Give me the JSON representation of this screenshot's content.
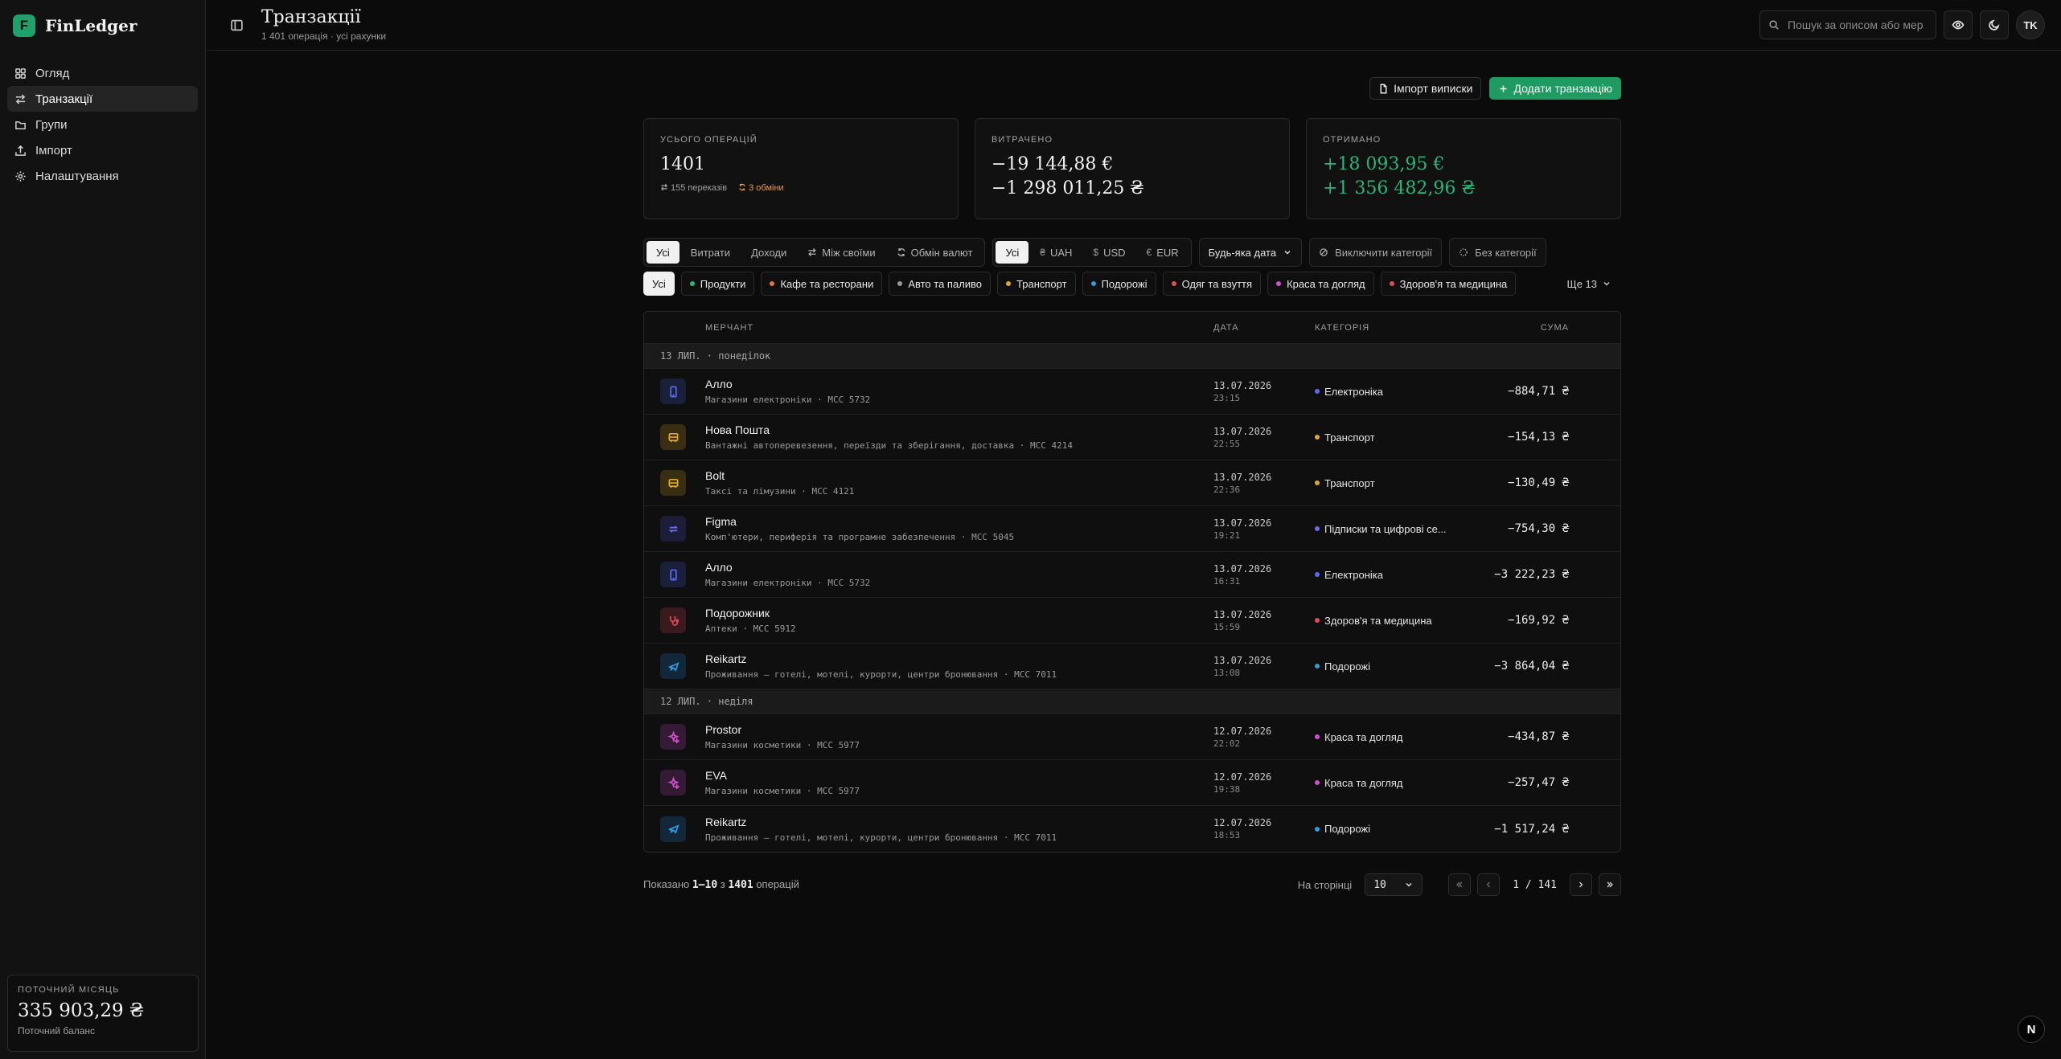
{
  "app": {
    "name": "FinLedger",
    "logo_letter": "F",
    "accent": "#22a06b"
  },
  "sidebar": {
    "items": [
      {
        "label": "Огляд",
        "icon": "grid-icon"
      },
      {
        "label": "Транзакції",
        "icon": "transfer-icon"
      },
      {
        "label": "Групи",
        "icon": "folder-icon"
      },
      {
        "label": "Імпорт",
        "icon": "upload-icon"
      },
      {
        "label": "Налаштування",
        "icon": "gear-icon"
      }
    ],
    "active_index": 1,
    "balance": {
      "label": "ПОТОЧНИЙ МІСЯЦЬ",
      "value": "335 903,29 ₴",
      "sub": "Поточний баланс"
    }
  },
  "header": {
    "title": "Транзакції",
    "subtitle": "1 401 операція · усі рахунки",
    "search_placeholder": "Пошук за описом або мер",
    "avatar": "TK"
  },
  "actions": {
    "import": "Імпорт виписки",
    "add": "Додати транзакцію"
  },
  "stats": {
    "total": {
      "label": "УСЬОГО ОПЕРАЦІЙ",
      "value": "1401",
      "transfers": "155 переказів",
      "exchanges": "3 обміни"
    },
    "spent": {
      "label": "ВИТРАЧЕНО",
      "eur": "−19 144,88 €",
      "uah": "−1 298 011,25 ₴"
    },
    "received": {
      "label": "ОТРИМАНО",
      "eur": "+18 093,95 €",
      "uah": "+1 356 482,96 ₴"
    }
  },
  "filters": {
    "type": [
      "Усі",
      "Витрати",
      "Доходи",
      "Між своїми",
      "Обмін валют"
    ],
    "currency": [
      {
        "label": "Усі",
        "symbol": ""
      },
      {
        "label": "UAH",
        "symbol": "₴"
      },
      {
        "label": "USD",
        "symbol": "$"
      },
      {
        "label": "EUR",
        "symbol": "€"
      }
    ],
    "date": "Будь-яка дата",
    "exclude": "Виключити категорії",
    "no_category": "Без категорії",
    "categories": [
      {
        "label": "Усі",
        "color": ""
      },
      {
        "label": "Продукти",
        "color": "#2bb47a"
      },
      {
        "label": "Кафе та ресторани",
        "color": "#e8743c"
      },
      {
        "label": "Авто та паливо",
        "color": "#9a9a9a"
      },
      {
        "label": "Транспорт",
        "color": "#e0a82e"
      },
      {
        "label": "Подорожі",
        "color": "#2f9be0"
      },
      {
        "label": "Одяг та взуття",
        "color": "#e0504f"
      },
      {
        "label": "Краса та догляд",
        "color": "#d24fd2"
      },
      {
        "label": "Здоров'я та медицина",
        "color": "#e04a5a"
      }
    ],
    "more": "Ще 13"
  },
  "table": {
    "headers": {
      "merchant": "МЕРЧАНТ",
      "date": "ДАТА",
      "category": "КАТЕГОРІЯ",
      "amount": "СУМА"
    },
    "groups": [
      {
        "label": "13 ЛИП. · понеділок",
        "rows": [
          {
            "name": "Алло",
            "desc": "Магазини електроніки · MCC 5732",
            "date": "13.07.2026",
            "time": "23:15",
            "category": "Електроніка",
            "cat_color": "#5b6cf0",
            "amount": "−884,71 ₴",
            "icon": "phone-icon",
            "icon_color": "#5b6cf0",
            "icon_bg": "#1a1f3a"
          },
          {
            "name": "Нова Пошта",
            "desc": "Вантажні автоперевезення, переїзди та зберігання, доставка · MCC 4214",
            "date": "13.07.2026",
            "time": "22:55",
            "category": "Транспорт",
            "cat_color": "#e0a82e",
            "amount": "−154,13 ₴",
            "icon": "bus-icon",
            "icon_color": "#e0a82e",
            "icon_bg": "#3a2e12"
          },
          {
            "name": "Bolt",
            "desc": "Таксі та лімузини · MCC 4121",
            "date": "13.07.2026",
            "time": "22:36",
            "category": "Транспорт",
            "cat_color": "#e0a82e",
            "amount": "−130,49 ₴",
            "icon": "bus-icon",
            "icon_color": "#e0a82e",
            "icon_bg": "#3a2e12"
          },
          {
            "name": "Figma",
            "desc": "Комп'ютери, периферія та програмне забезпечення · MCC 5045",
            "date": "13.07.2026",
            "time": "19:21",
            "category": "Підписки та цифрові се...",
            "cat_color": "#6b6cf0",
            "amount": "−754,30 ₴",
            "icon": "repeat-icon",
            "icon_color": "#6b6cf0",
            "icon_bg": "#1d1d3a"
          },
          {
            "name": "Алло",
            "desc": "Магазини електроніки · MCC 5732",
            "date": "13.07.2026",
            "time": "16:31",
            "category": "Електроніка",
            "cat_color": "#5b6cf0",
            "amount": "−3 222,23 ₴",
            "icon": "phone-icon",
            "icon_color": "#5b6cf0",
            "icon_bg": "#1a1f3a"
          },
          {
            "name": "Подорожник",
            "desc": "Аптеки · MCC 5912",
            "date": "13.07.2026",
            "time": "15:59",
            "category": "Здоров'я та медицина",
            "cat_color": "#e04a5a",
            "amount": "−169,92 ₴",
            "icon": "stethoscope-icon",
            "icon_color": "#e04a5a",
            "icon_bg": "#3a1a1e"
          },
          {
            "name": "Reikartz",
            "desc": "Проживання — готелі, мотелі, курорти, центри бронювання · MCC 7011",
            "date": "13.07.2026",
            "time": "13:08",
            "category": "Подорожі",
            "cat_color": "#2f9be0",
            "amount": "−3 864,04 ₴",
            "icon": "plane-icon",
            "icon_color": "#2f9be0",
            "icon_bg": "#12283a"
          }
        ]
      },
      {
        "label": "12 ЛИП. · неділя",
        "rows": [
          {
            "name": "Prostor",
            "desc": "Магазини косметики · MCC 5977",
            "date": "12.07.2026",
            "time": "22:02",
            "category": "Краса та догляд",
            "cat_color": "#d24fd2",
            "amount": "−434,87 ₴",
            "icon": "sparkle-icon",
            "icon_color": "#d24fd2",
            "icon_bg": "#351a35"
          },
          {
            "name": "EVA",
            "desc": "Магазини косметики · MCC 5977",
            "date": "12.07.2026",
            "time": "19:38",
            "category": "Краса та догляд",
            "cat_color": "#d24fd2",
            "amount": "−257,47 ₴",
            "icon": "sparkle-icon",
            "icon_color": "#d24fd2",
            "icon_bg": "#351a35"
          },
          {
            "name": "Reikartz",
            "desc": "Проживання — готелі, мотелі, курорти, центри бронювання · MCC 7011",
            "date": "12.07.2026",
            "time": "18:53",
            "category": "Подорожі",
            "cat_color": "#2f9be0",
            "amount": "−1 517,24 ₴",
            "icon": "plane-icon",
            "icon_color": "#2f9be0",
            "icon_bg": "#12283a"
          }
        ]
      }
    ]
  },
  "pager": {
    "shown_prefix": "Показано",
    "range": "1–10",
    "of_word": "з",
    "total": "1401",
    "suffix": "операцій",
    "per_page_label": "На сторінці",
    "per_page": "10",
    "page": "1",
    "pages": "141"
  },
  "floating": {
    "letter": "N"
  }
}
